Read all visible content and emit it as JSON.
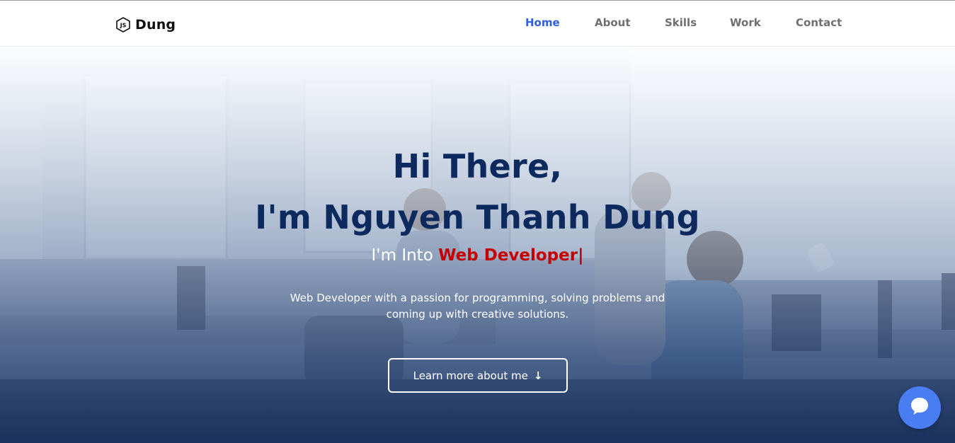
{
  "brand": {
    "name": "Dung",
    "icon": "nodejs-hexagon-icon"
  },
  "nav": {
    "items": [
      {
        "label": "Home",
        "active": true
      },
      {
        "label": "About",
        "active": false
      },
      {
        "label": "Skills",
        "active": false
      },
      {
        "label": "Work",
        "active": false
      },
      {
        "label": "Contact",
        "active": false
      }
    ]
  },
  "hero": {
    "greeting": "Hi There,",
    "name_line": "I'm Nguyen Thanh Dung",
    "typing_prefix": "I'm Into ",
    "typing_role": "Web Developer|",
    "description": "Web Developer with a passion for programming, solving problems and coming up with creative solutions.",
    "cta_label": "Learn more about me",
    "cta_icon": "arrow-down-icon"
  },
  "chat_widget": {
    "icon": "chat-bubble-icon"
  },
  "colors": {
    "accent": "#2f5fdc",
    "heading": "#0c2a5e",
    "role": "#c40000",
    "chat": "#4a7cf2"
  }
}
